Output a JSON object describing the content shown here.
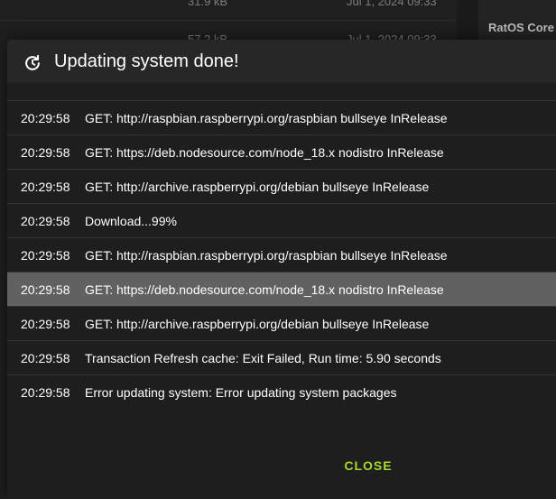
{
  "background": {
    "rows": [
      {
        "size": "31.9 kB",
        "date": "Jul 1, 2024 09:33"
      },
      {
        "size": "57.2 kB",
        "date": "Jul 1, 2024 09:33"
      }
    ],
    "side_panel_title": "RatOS Core"
  },
  "dialog": {
    "title": "Updating system done!",
    "icon": "refresh-icon",
    "close_label": "CLOSE",
    "accent_color": "#a6d82b",
    "log": [
      {
        "time": "20:29:58",
        "message": "GET: http://raspbian.raspberrypi.org/raspbian bullseye InRelease"
      },
      {
        "time": "20:29:58",
        "message": "GET: https://deb.nodesource.com/node_18.x nodistro InRelease"
      },
      {
        "time": "20:29:58",
        "message": "GET: http://archive.raspberrypi.org/debian bullseye InRelease"
      },
      {
        "time": "20:29:58",
        "message": "Download...99%"
      },
      {
        "time": "20:29:58",
        "message": "GET: http://raspbian.raspberrypi.org/raspbian bullseye InRelease"
      },
      {
        "time": "20:29:58",
        "message": "GET: https://deb.nodesource.com/node_18.x nodistro InRelease",
        "selected": true
      },
      {
        "time": "20:29:58",
        "message": "GET: http://archive.raspberrypi.org/debian bullseye InRelease"
      },
      {
        "time": "20:29:58",
        "message": "Transaction Refresh cache: Exit Failed, Run time: 5.90 seconds"
      },
      {
        "time": "20:29:58",
        "message": "Error updating system: Error updating system packages"
      }
    ]
  }
}
